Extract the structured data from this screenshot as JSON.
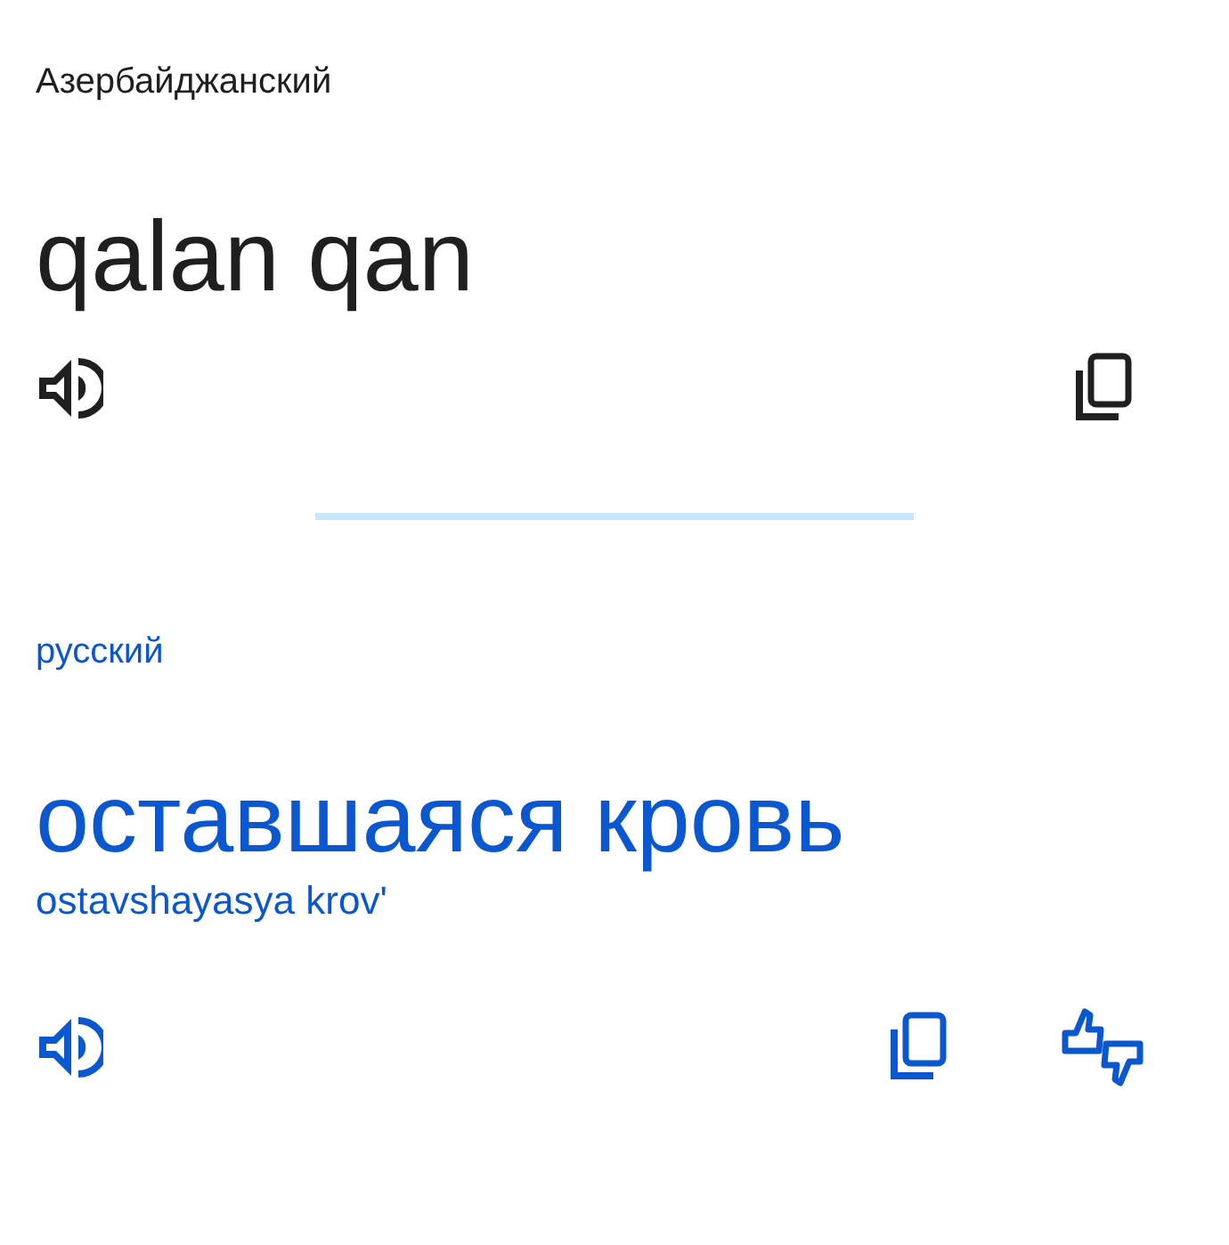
{
  "source": {
    "language": "Азербайджанский",
    "text": "qalan qan"
  },
  "target": {
    "language": "русский",
    "text": "оставшаяся кровь",
    "transliteration": "ostavshayasya krov'"
  }
}
